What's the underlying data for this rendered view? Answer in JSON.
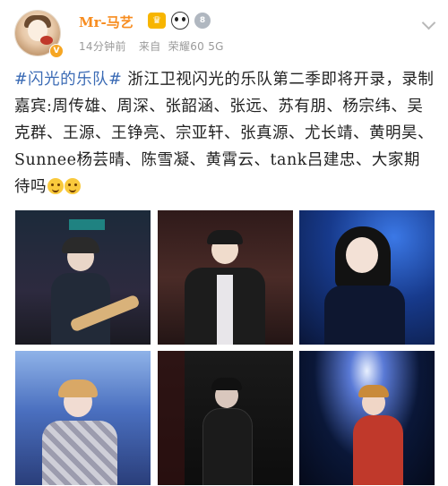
{
  "user": {
    "name": "Mr-马艺",
    "vip_badge": "V",
    "level_badge": "8"
  },
  "meta": {
    "time": "14分钟前",
    "source_label": "来自",
    "device": "荣耀60 5G"
  },
  "post": {
    "hashtag": "#闪光的乐队#",
    "text": " 浙江卫视闪光的乐队第二季即将开录，录制嘉宾:周传雄、周深、张韶涵、张远、苏有朋、杨宗纬、吴克群、王源、王铮亮、宗亚轩、张真源、尤长靖、黄明昊、Sunnee杨芸晴、陈雪凝、黄霄云、tank吕建忠、大家期待吗"
  },
  "photos": [
    {
      "id": "photo-1",
      "bg": "#2a2a3a",
      "accent": "#1fa8a0"
    },
    {
      "id": "photo-2",
      "bg": "#3a2424",
      "accent": "#c44a38"
    },
    {
      "id": "photo-3",
      "bg": "#0f2250",
      "accent": "#3f6fd8"
    },
    {
      "id": "photo-4",
      "bg": "#3d5fa8",
      "accent": "#a9c4ef"
    },
    {
      "id": "photo-5",
      "bg": "#151515",
      "accent": "#3a3a3a"
    },
    {
      "id": "photo-6",
      "bg": "#07122a",
      "accent": "#b9d2ff"
    }
  ],
  "colors": {
    "username": "#f78c1f",
    "hashtag": "#3b6bb5",
    "meta": "#9a9a9a"
  }
}
